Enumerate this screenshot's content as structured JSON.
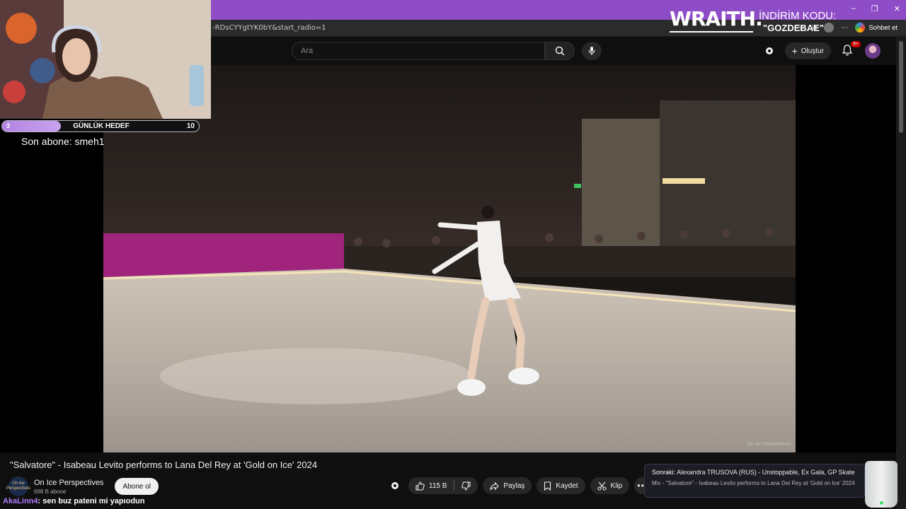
{
  "browser": {
    "url": "-RDsCYYgtYK0bY&start_radio=1",
    "chat_label": "Sohbet et",
    "window_controls": [
      "–",
      "❐",
      "✕"
    ]
  },
  "header": {
    "search_placeholder": "Ara",
    "create_label": "Oluştur",
    "notification_count": "9+"
  },
  "overlay": {
    "goal_current": "3",
    "goal_label": "GÜNLÜK HEDEF",
    "goal_target": "10",
    "goal_progress": 0.3,
    "last_sub": "Son abone: smeh1",
    "promo_brand": "WRAITH.",
    "promo_label": "İNDİRİM KODU:",
    "promo_code": "\"GOZDEBAE\""
  },
  "video": {
    "title": "\"Salvatore\" - Isabeau Levito performs to Lana Del Rey at 'Gold on Ice' 2024",
    "watermark": "On Ice Perspectives"
  },
  "channel": {
    "avatar_text": "On Ice Perspectives",
    "name": "On Ice Perspectives",
    "subs": "698 B abone",
    "subscribe_label": "Abone ol"
  },
  "actions": {
    "likes": "115 B",
    "share": "Paylaş",
    "save": "Kaydet",
    "clip": "Klip"
  },
  "up_next": {
    "label": "Sonraki:",
    "title": "Alexandra TRUSOVA (RUS) - Unstoppable, Ex Gala, GP Skate ...",
    "playlist": "Mix - \"Salvatore\" - Isabeau Levito performs to Lana Del Rey at 'Gold on Ice' 2024"
  },
  "chat": {
    "user": "AkaLinn4",
    "message": ": sen buz pateni mi yapıodun"
  },
  "colors": {
    "accent_purple": "#8e4cc7",
    "background": "#0f0f0f",
    "goal_fill": "#b283e0"
  }
}
